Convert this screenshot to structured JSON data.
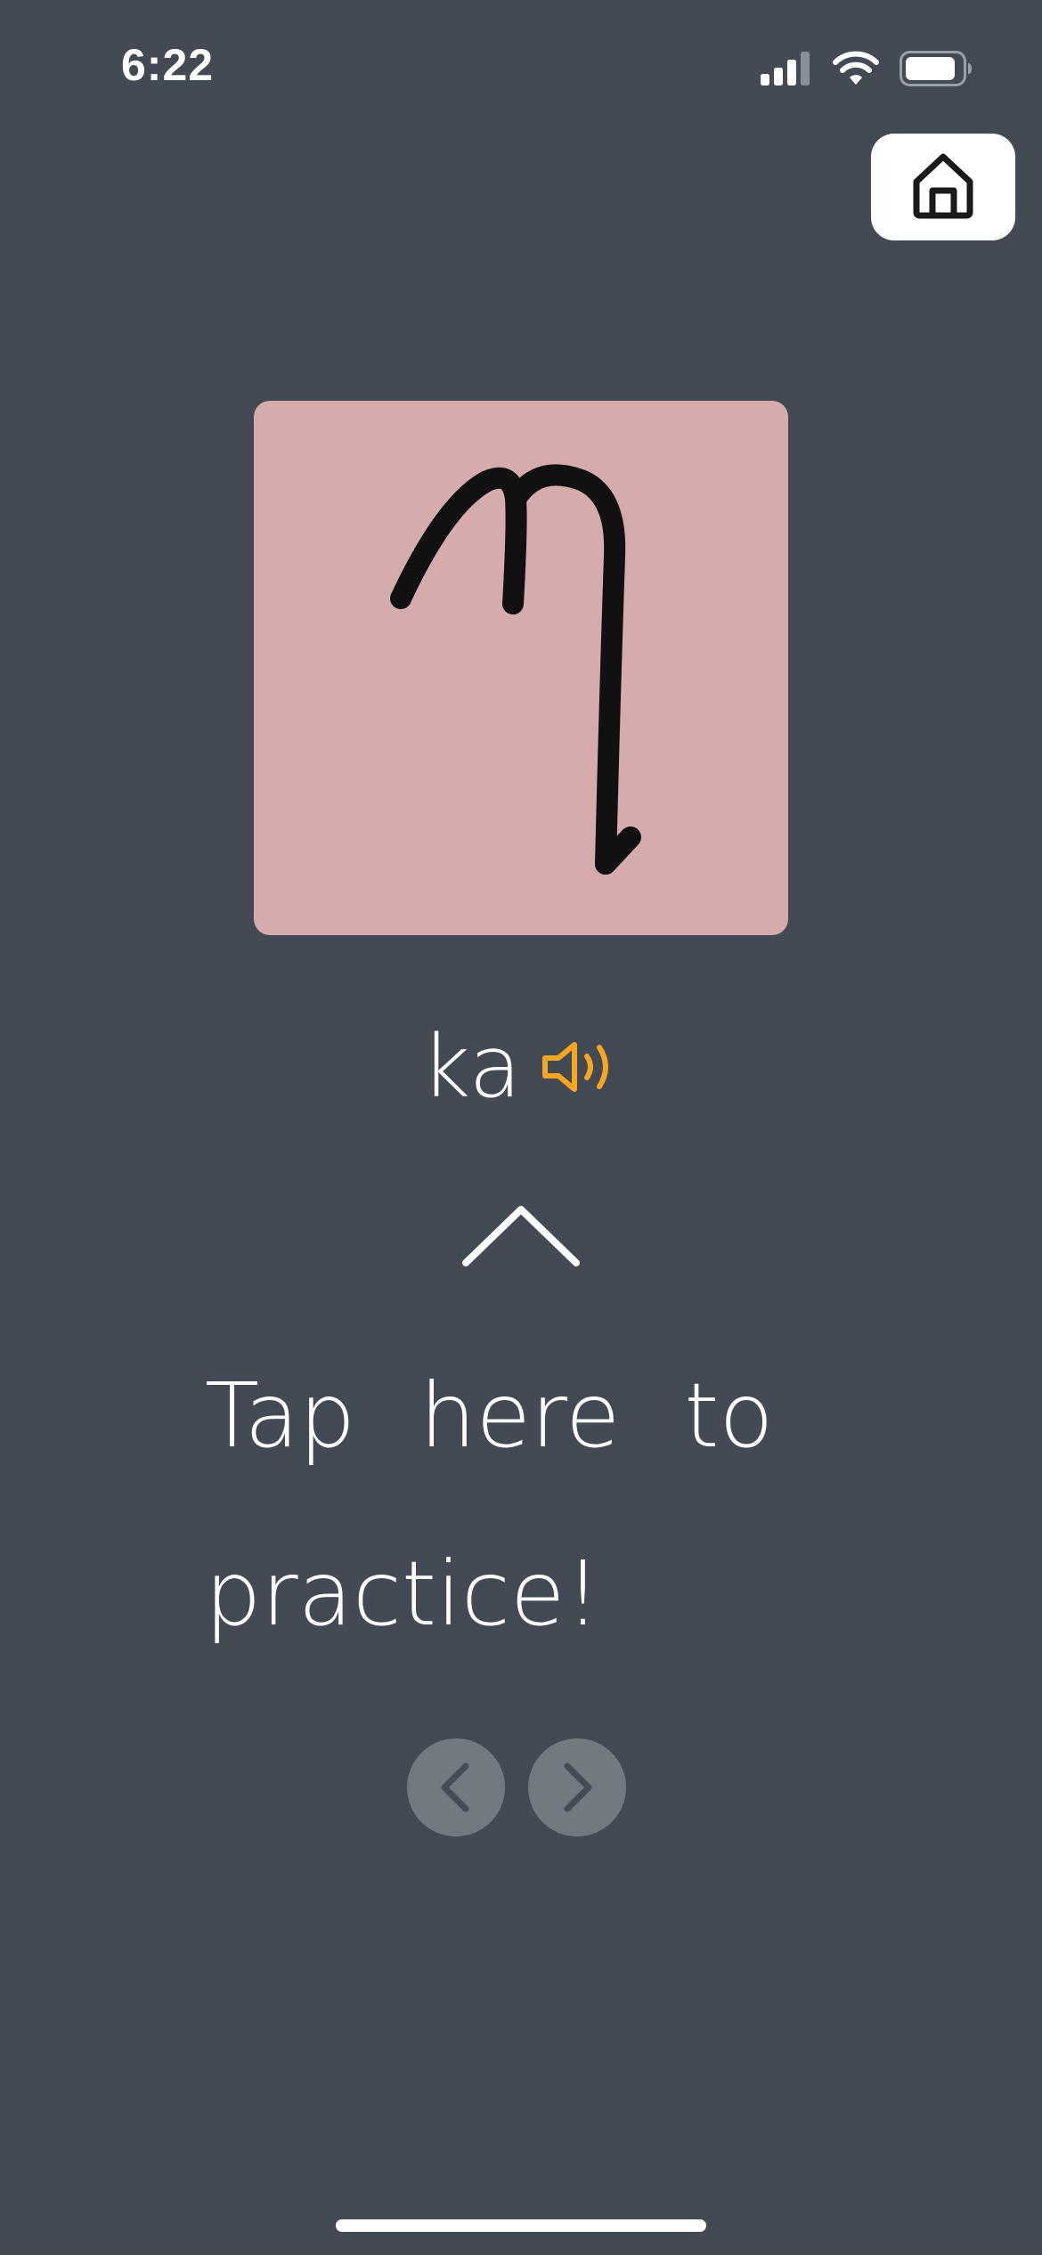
{
  "status_bar": {
    "time": "6:22",
    "icons": [
      "cellular-signal-icon",
      "wifi-icon",
      "battery-icon"
    ]
  },
  "home_button": {
    "icon": "home-icon"
  },
  "card": {
    "character": "ኸ-style handwritten glyph",
    "background_color": "#d5abad"
  },
  "romanization": {
    "text": "ka",
    "audio_icon": "speaker-icon",
    "audio_icon_color": "#f5a623"
  },
  "practice": {
    "chevron_icon": "chevron-up-icon",
    "prompt_line1": "Tap here to",
    "prompt_line2": "practice!"
  },
  "navigation": {
    "previous_icon": "chevron-left-icon",
    "next_icon": "chevron-right-icon"
  },
  "colors": {
    "background": "#434a54",
    "nav_button": "#737980",
    "accent": "#f5a623"
  }
}
